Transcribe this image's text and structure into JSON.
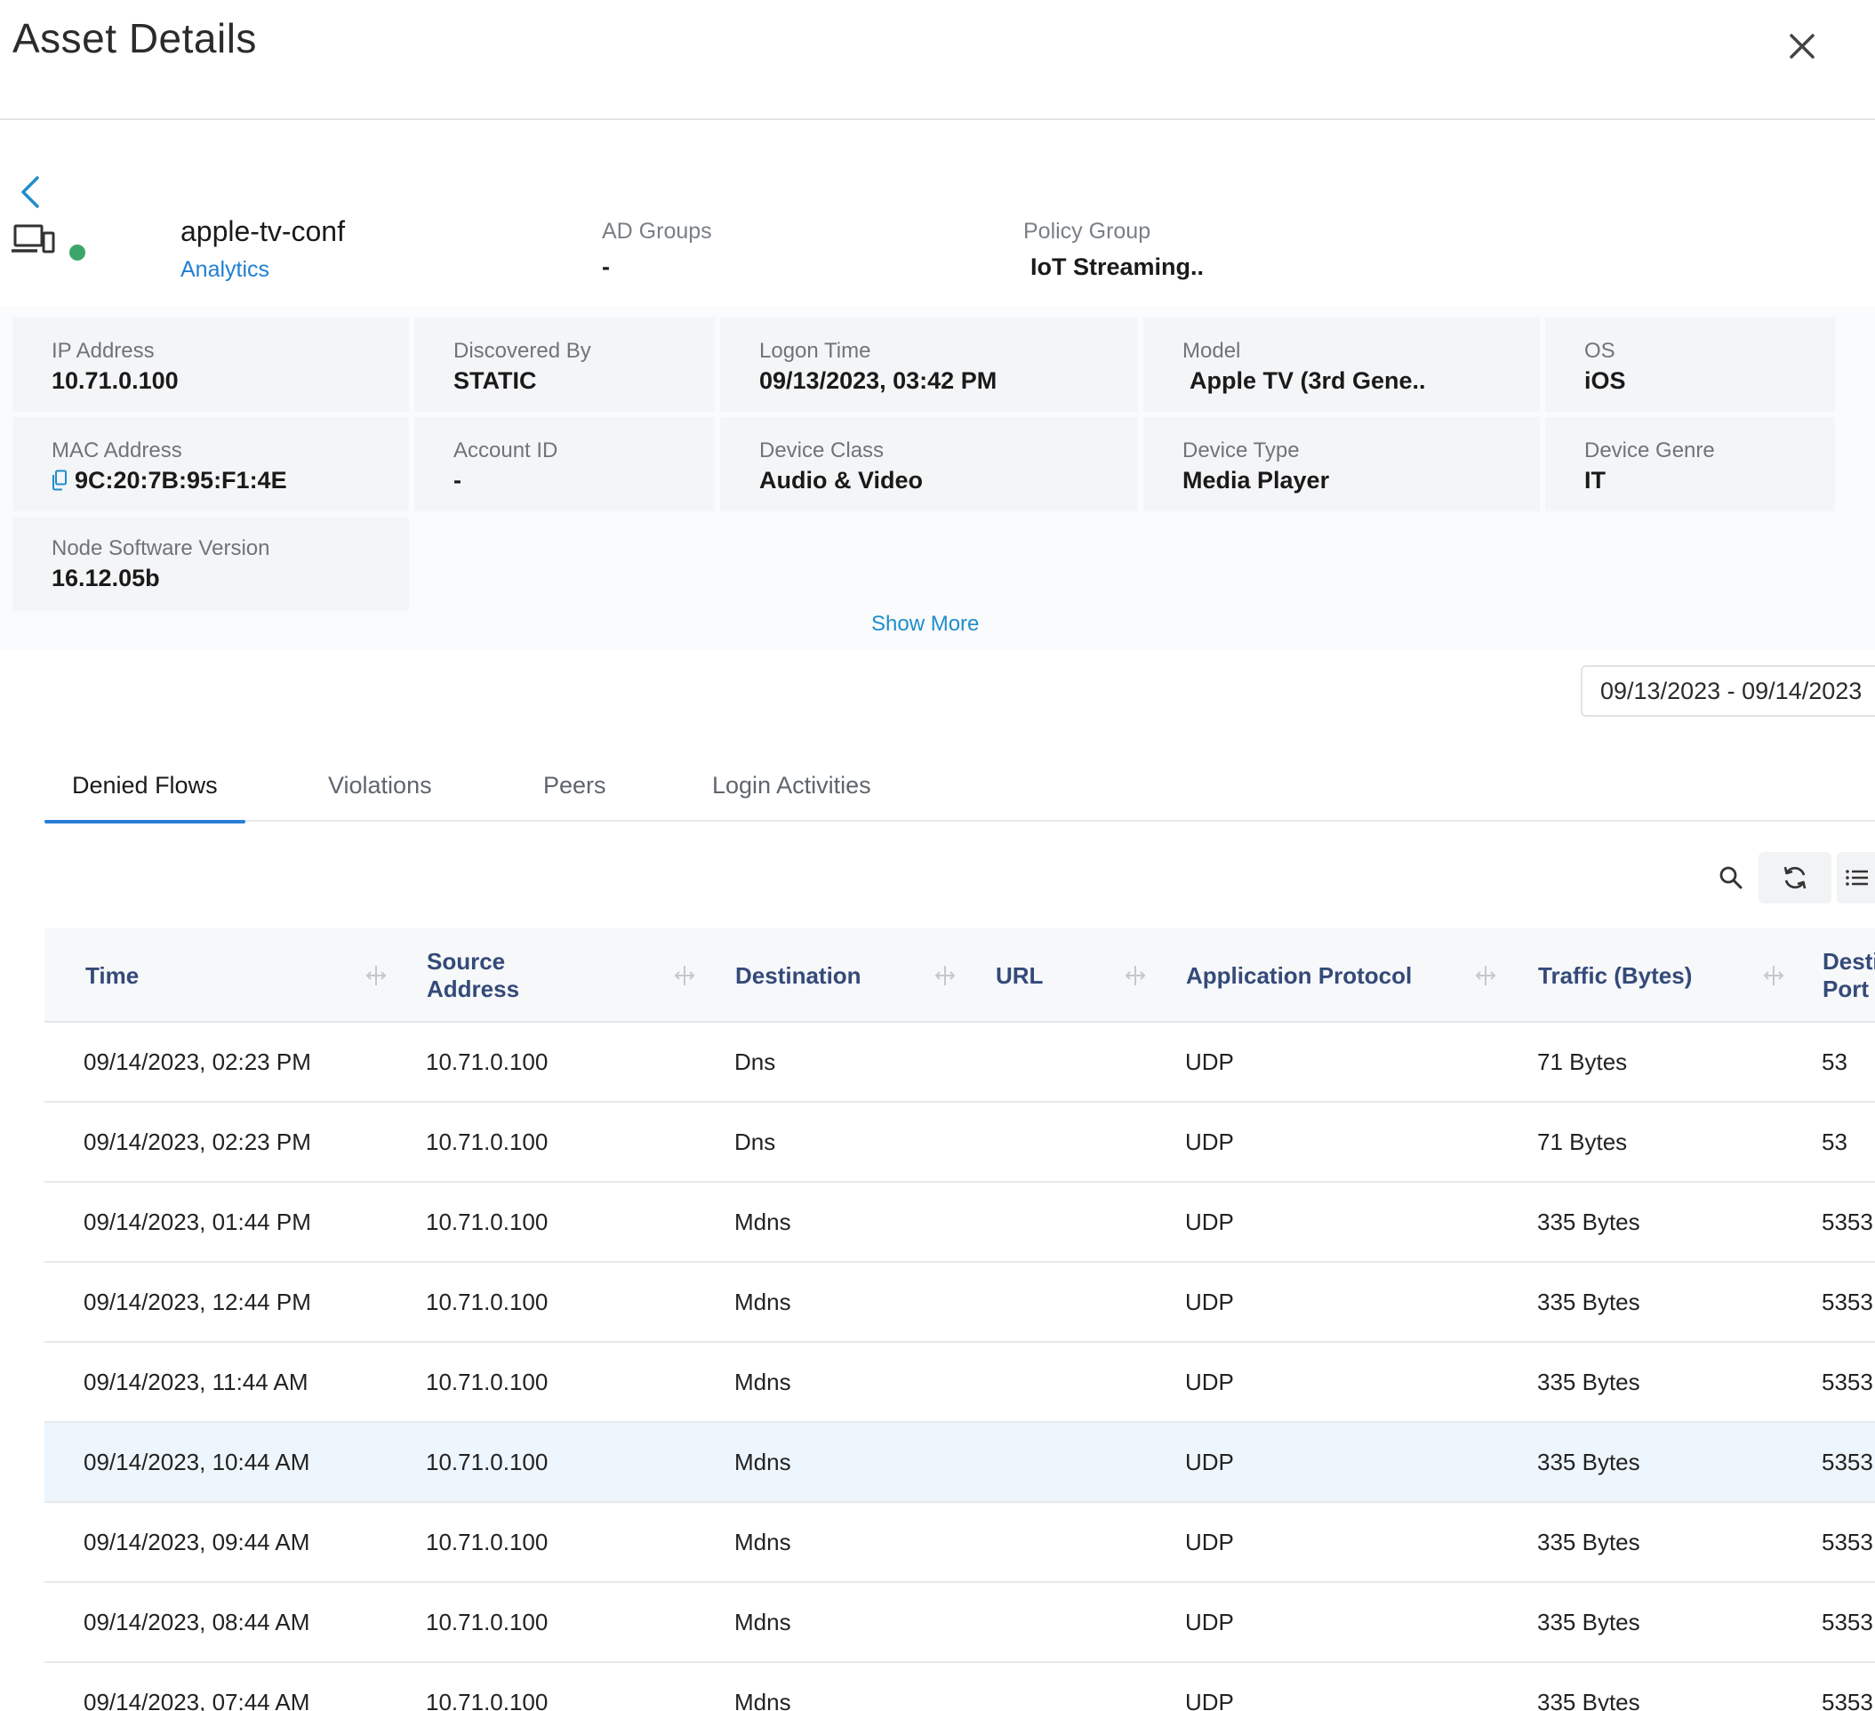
{
  "header": {
    "title": "Asset Details"
  },
  "asset": {
    "name": "apple-tv-conf",
    "analytics_link": "Analytics",
    "ad_groups_label": "AD Groups",
    "ad_groups_value": "-",
    "policy_group_label": "Policy Group",
    "policy_group_value": "IoT Streaming..",
    "status_color": "#3aa66a"
  },
  "info": [
    {
      "label": "IP Address",
      "value": "10.71.0.100"
    },
    {
      "label": "Discovered By",
      "value": "STATIC"
    },
    {
      "label": "Logon Time",
      "value": "09/13/2023, 03:42 PM"
    },
    {
      "label": "Model",
      "value": "Apple TV (3rd Gene.."
    },
    {
      "label": "OS",
      "value": "iOS"
    },
    {
      "label": "MAC Address",
      "value": "9C:20:7B:95:F1:4E"
    },
    {
      "label": "Account ID",
      "value": "-"
    },
    {
      "label": "Device Class",
      "value": "Audio & Video"
    },
    {
      "label": "Device Type",
      "value": "Media Player"
    },
    {
      "label": "Device Genre",
      "value": "IT"
    },
    {
      "label": "Node Software Version",
      "value": "16.12.05b"
    }
  ],
  "show_more": "Show More",
  "date_range": "09/13/2023 - 09/14/2023",
  "tabs": [
    {
      "label": "Denied Flows",
      "active": true
    },
    {
      "label": "Violations",
      "active": false
    },
    {
      "label": "Peers",
      "active": false
    },
    {
      "label": "Login Activities",
      "active": false
    }
  ],
  "table": {
    "columns": [
      {
        "line1": "Time",
        "line2": ""
      },
      {
        "line1": "Source",
        "line2": "Address"
      },
      {
        "line1": "Destination",
        "line2": ""
      },
      {
        "line1": "URL",
        "line2": ""
      },
      {
        "line1": "Application Protocol",
        "line2": ""
      },
      {
        "line1": "Traffic (Bytes)",
        "line2": ""
      },
      {
        "line1": "Destination",
        "line2": "Port"
      }
    ],
    "rows": [
      [
        "09/14/2023, 02:23 PM",
        "10.71.0.100",
        "Dns",
        "",
        "UDP",
        "71 Bytes",
        "53"
      ],
      [
        "09/14/2023, 02:23 PM",
        "10.71.0.100",
        "Dns",
        "",
        "UDP",
        "71 Bytes",
        "53"
      ],
      [
        "09/14/2023, 01:44 PM",
        "10.71.0.100",
        "Mdns",
        "",
        "UDP",
        "335 Bytes",
        "5353"
      ],
      [
        "09/14/2023, 12:44 PM",
        "10.71.0.100",
        "Mdns",
        "",
        "UDP",
        "335 Bytes",
        "5353"
      ],
      [
        "09/14/2023, 11:44 AM",
        "10.71.0.100",
        "Mdns",
        "",
        "UDP",
        "335 Bytes",
        "5353"
      ],
      [
        "09/14/2023, 10:44 AM",
        "10.71.0.100",
        "Mdns",
        "",
        "UDP",
        "335 Bytes",
        "5353"
      ],
      [
        "09/14/2023, 09:44 AM",
        "10.71.0.100",
        "Mdns",
        "",
        "UDP",
        "335 Bytes",
        "5353"
      ],
      [
        "09/14/2023, 08:44 AM",
        "10.71.0.100",
        "Mdns",
        "",
        "UDP",
        "335 Bytes",
        "5353"
      ],
      [
        "09/14/2023, 07:44 AM",
        "10.71.0.100",
        "Mdns",
        "",
        "UDP",
        "335 Bytes",
        "5353"
      ]
    ],
    "highlighted_row": 5
  },
  "icons": {
    "close": "close-icon",
    "back": "chevron-left-icon",
    "device": "device-icon",
    "copy": "copy-icon",
    "search": "search-icon",
    "refresh": "refresh-icon",
    "columns": "column-list-icon",
    "resize": "column-resize-icon"
  },
  "colors": {
    "accent": "#2a7dd6",
    "link": "#1f7fd1",
    "header_text": "#344a78"
  }
}
